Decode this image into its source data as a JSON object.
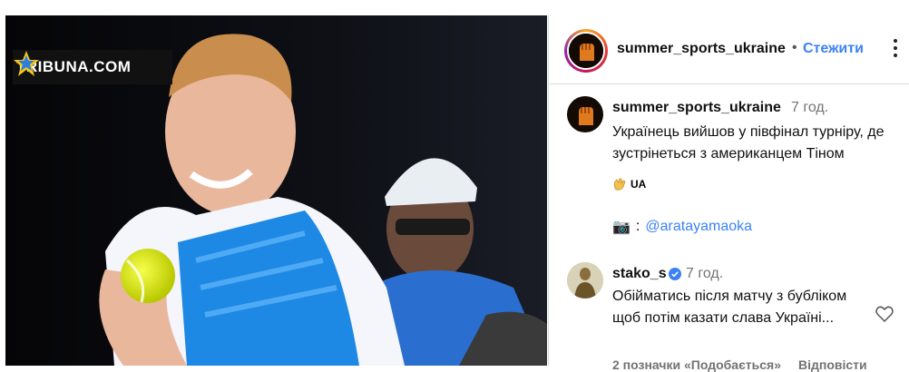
{
  "photo": {
    "watermark": "TRIBUNA.COM"
  },
  "header": {
    "username": "summer_sports_ukraine",
    "dot": "•",
    "follow_label": "Стежити"
  },
  "caption": {
    "username": "summer_sports_ukraine",
    "time": "7 год.",
    "text": "Українець вийшов у півфінал турніру, де зустрінеться з американцем Тіном",
    "flag_label": "UA",
    "camera_icon": "📷",
    "camera_sep": ":",
    "mention": "@aratayamaoka"
  },
  "comment": {
    "username": "stako_s",
    "time": "7 год.",
    "text": "Обійматись після матчу з бубліком щоб потім казати слава Україні...",
    "likes": "2 позначки «Подобається»",
    "reply_label": "Відповісти"
  },
  "colors": {
    "accent": "#3b82f6",
    "muted": "#737373",
    "shirt_blue": "#1e88e5"
  }
}
